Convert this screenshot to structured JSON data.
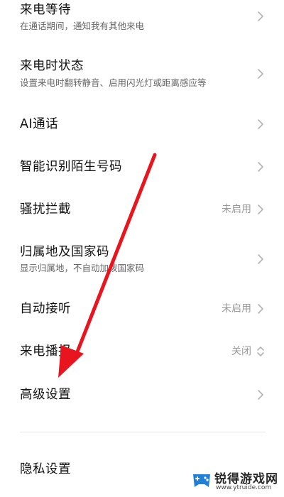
{
  "settings": {
    "items": [
      {
        "title": "来电等待",
        "subtitle": "在通话期间，通知我有其他来电",
        "value": ""
      },
      {
        "title": "来电时状态",
        "subtitle": "设置来电时翻转静音、启用闪光灯或距离感应等",
        "value": ""
      },
      {
        "title": "AI通话",
        "subtitle": "",
        "value": ""
      },
      {
        "title": "智能识别陌生号码",
        "subtitle": "",
        "value": ""
      },
      {
        "title": "骚扰拦截",
        "subtitle": "",
        "value": "未启用"
      },
      {
        "title": "归属地及国家码",
        "subtitle": "显示归属地，不自动加拨国家码",
        "value": ""
      },
      {
        "title": "自动接听",
        "subtitle": "",
        "value": "未启用"
      },
      {
        "title": "来电播报",
        "subtitle": "",
        "value": "关闭"
      },
      {
        "title": "高级设置",
        "subtitle": "",
        "value": ""
      },
      {
        "title": "隐私设置",
        "subtitle": "",
        "value": ""
      }
    ]
  },
  "annotation": {
    "arrow_color": "#e8141e"
  },
  "watermark": {
    "name": "锐得游戏网",
    "url": "www.ytruide.com"
  },
  "colors": {
    "title": "#111111",
    "subtitle": "#666666",
    "value": "#999999",
    "chevron": "#b3b3b3",
    "divider": "#e6e6e6"
  }
}
